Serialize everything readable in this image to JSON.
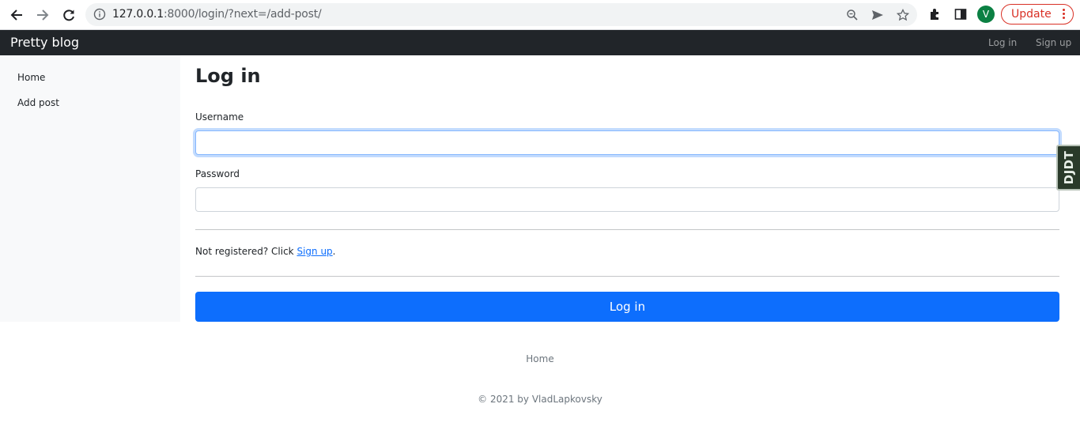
{
  "browser": {
    "url_host": "127.0.0.1",
    "url_rest": ":8000/login/?next=/add-post/",
    "profile_initial": "V",
    "update_label": "Update"
  },
  "navbar": {
    "brand": "Pretty blog",
    "links": [
      "Log in",
      "Sign up"
    ]
  },
  "sidebar": {
    "items": [
      "Home",
      "Add post"
    ]
  },
  "main": {
    "title": "Log in",
    "username_label": "Username",
    "username_value": "",
    "password_label": "Password",
    "password_value": "",
    "note_prefix": "Not registered? Click ",
    "note_link": "Sign up",
    "note_suffix": ".",
    "submit_label": "Log in"
  },
  "debug_toolbar": {
    "label": "DJDT"
  },
  "footer": {
    "link": "Home",
    "copyright": "© 2021 by VladLapkovsky"
  },
  "colors": {
    "navbar_bg": "#212529",
    "primary": "#0d6efd",
    "sidebar_bg": "#f8f9fa",
    "update_red": "#d93025"
  }
}
